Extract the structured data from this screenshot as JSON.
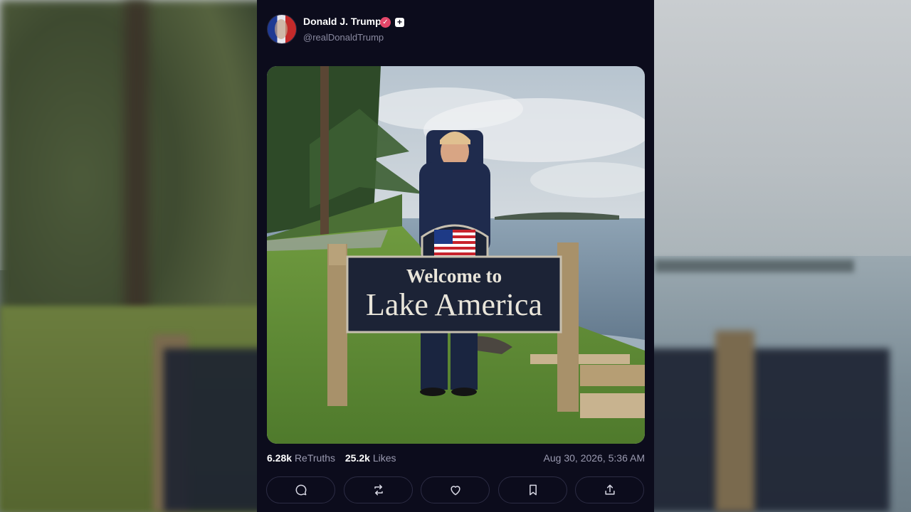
{
  "post": {
    "author_name": "Donald J. Trump",
    "author_handle": "@realDonaldTrump",
    "verified_badge": "verified-icon",
    "plus_badge": "+",
    "image": {
      "sign_line1": "Welcome to",
      "sign_line2": "Lake America"
    },
    "retruths_count": "6.28k",
    "retruths_label": "ReTruths",
    "likes_count": "25.2k",
    "likes_label": "Likes",
    "timestamp": "Aug 30, 2026, 5:36 AM"
  },
  "actions": [
    {
      "name": "reply",
      "icon": "comment-icon"
    },
    {
      "name": "retruth",
      "icon": "repost-icon"
    },
    {
      "name": "like",
      "icon": "heart-icon"
    },
    {
      "name": "bookmark",
      "icon": "bookmark-icon"
    },
    {
      "name": "share",
      "icon": "share-icon"
    }
  ],
  "colors": {
    "panel_bg": "#0c0c1c",
    "badge_pink": "#e5476a",
    "muted_text": "#9a9ab0"
  }
}
